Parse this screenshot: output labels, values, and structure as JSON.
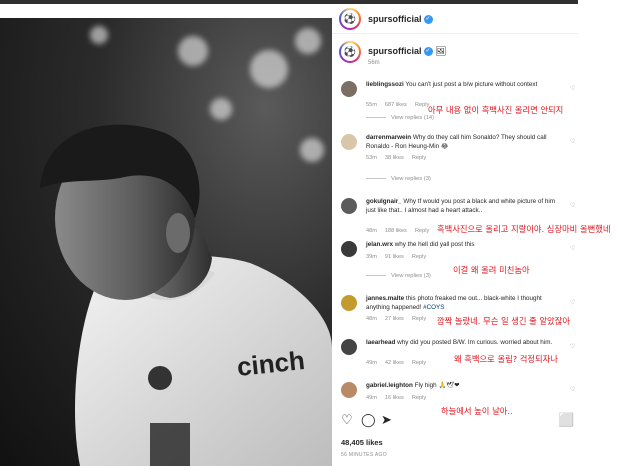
{
  "post": {
    "account": "spursofficial",
    "caption_account": "spursofficial",
    "caption_emoji": "🖼",
    "caption_time": "56m",
    "likes": "48,405 likes",
    "time_ago": "56 MINUTES AGO"
  },
  "comments": [
    {
      "user": "lieblingssozi",
      "text": "You can't just post a b/w picture without context",
      "time": "55m",
      "likes": "687 likes",
      "reply": "Reply",
      "view_replies": "View replies (14)",
      "translation": "아무 내용 없이 흑백사진 올리면 안되지"
    },
    {
      "user": "darrenmarwein",
      "text": "Why do they call him Sonaldo? They should call Ronaldo - Ron Heung-Min 😂",
      "time": "53m",
      "likes": "38 likes",
      "reply": "Reply",
      "view_replies": "View replies (3)",
      "translation": ""
    },
    {
      "user": "gokulgnair_",
      "text": "Why tf would you post a black and white picture of him just like that.. I almost had a heart attack..",
      "time": "48m",
      "likes": "188 likes",
      "reply": "Reply",
      "view_replies": "",
      "translation": "흑백사진으로 올리고 지랄이야. 심장마비 올뻔했네"
    },
    {
      "user": "jelan.wrx",
      "text": "why the hell did yall post this",
      "time": "39m",
      "likes": "91 likes",
      "reply": "Reply",
      "view_replies": "View replies (3)",
      "translation": "이걸 왜 올려 미친놈아"
    },
    {
      "user": "jannes.malte",
      "text": "this photo freaked me out... black-white I thought anything happened!",
      "hashtag": "#COYS",
      "time": "48m",
      "likes": "27 likes",
      "reply": "Reply",
      "view_replies": "",
      "translation": "깜짝 놀랐네. 무슨 일 생긴 줄 알았잖아"
    },
    {
      "user": "laearhead",
      "text": "why did you posted B/W. Im curious. worried about him.",
      "time": "49m",
      "likes": "42 likes",
      "reply": "Reply",
      "view_replies": "",
      "translation": "왜 흑백으로 올림? 걱정되자나"
    },
    {
      "user": "gabriel.leighton",
      "text": "Fly high 🙏🕊❤",
      "time": "49m",
      "likes": "16 likes",
      "reply": "Reply",
      "view_replies": "",
      "translation": "하늘에서 높이 날아.."
    }
  ],
  "colors": {
    "annotation": "#e0131c",
    "verified": "#3897f0",
    "link": "#00376b"
  },
  "icons": [
    "heart-icon",
    "comment-icon",
    "share-icon",
    "bookmark-icon",
    "verified-icon"
  ]
}
